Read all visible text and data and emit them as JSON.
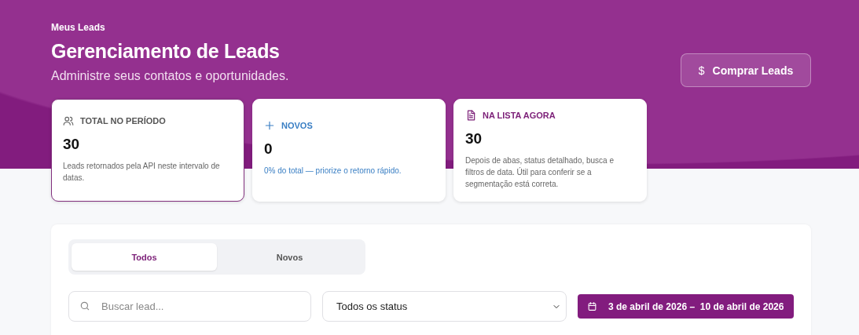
{
  "header": {
    "breadcrumb": "Meus Leads",
    "title": "Gerenciamento de Leads",
    "subtitle": "Administre seus contatos e oportunidades.",
    "buy_button": {
      "icon": "$",
      "label": "Comprar Leads"
    }
  },
  "stat_cards": [
    {
      "kind": "total",
      "selected": true,
      "label": "TOTAL NO PERÍODO",
      "value": "30",
      "description": "Leads retornados pela API neste intervalo de datas."
    },
    {
      "kind": "new",
      "selected": false,
      "label": "NOVOS",
      "value": "0",
      "description": "0% do total — priorize o retorno rápido."
    },
    {
      "kind": "list",
      "selected": false,
      "label": "NA LISTA AGORA",
      "value": "30",
      "description": "Depois de abas, status detalhado, busca e filtros de data. Útil para conferir se a segmentação está correta."
    }
  ],
  "tabs": [
    {
      "label": "Todos",
      "selected": true
    },
    {
      "label": "Novos",
      "selected": false
    }
  ],
  "filters": {
    "search": {
      "placeholder": "Buscar lead..."
    },
    "status_select": {
      "value": "Todos os status"
    },
    "date_range": {
      "label": "3 de abril de 2026 –  10 de abril de 2026"
    }
  }
}
